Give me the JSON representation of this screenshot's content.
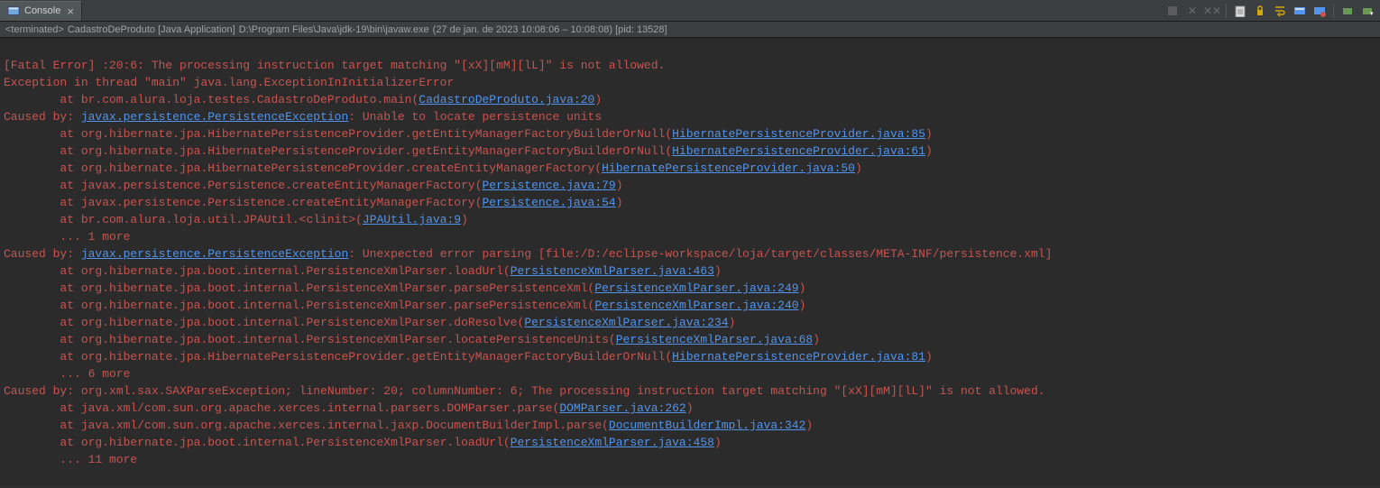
{
  "tab": {
    "label": "Console"
  },
  "status": {
    "terminated": "<terminated>",
    "app": "CadastroDeProduto [Java Application]",
    "path": "D:\\Program Files\\Java\\jdk-19\\bin\\javaw.exe",
    "meta": "(27 de jan. de 2023 10:08:06 – 10:08:08) [pid: 13528]"
  },
  "lines": {
    "l1a": "[Fatal Error] :20:6: The processing instruction target matching \"[xX][mM][lL]\" is not allowed.",
    "l2a": "Exception in thread \"main\" ",
    "l2b": "java.lang.ExceptionInInitializerError",
    "l3a": "\tat br.com.alura.loja.testes.CadastroDeProduto.main(",
    "l3l": "CadastroDeProduto.java:20",
    "l3c": ")",
    "l4a": "Caused by: ",
    "l4l": "javax.persistence.PersistenceException",
    "l4b": ": Unable to locate persistence units",
    "l5a": "\tat org.hibernate.jpa.HibernatePersistenceProvider.getEntityManagerFactoryBuilderOrNull(",
    "l5l": "HibernatePersistenceProvider.java:85",
    "l5c": ")",
    "l6a": "\tat org.hibernate.jpa.HibernatePersistenceProvider.getEntityManagerFactoryBuilderOrNull(",
    "l6l": "HibernatePersistenceProvider.java:61",
    "l6c": ")",
    "l7a": "\tat org.hibernate.jpa.HibernatePersistenceProvider.createEntityManagerFactory(",
    "l7l": "HibernatePersistenceProvider.java:50",
    "l7c": ")",
    "l8a": "\tat javax.persistence.Persistence.createEntityManagerFactory(",
    "l8l": "Persistence.java:79",
    "l8c": ")",
    "l9a": "\tat javax.persistence.Persistence.createEntityManagerFactory(",
    "l9l": "Persistence.java:54",
    "l9c": ")",
    "l10a": "\tat br.com.alura.loja.util.JPAUtil.<clinit>(",
    "l10l": "JPAUtil.java:9",
    "l10c": ")",
    "l11a": "\t... 1 more",
    "l12a": "Caused by: ",
    "l12l": "javax.persistence.PersistenceException",
    "l12b": ": Unexpected error parsing [file:/D:/eclipse-workspace/loja/target/classes/META-INF/persistence.xml]",
    "l13a": "\tat org.hibernate.jpa.boot.internal.PersistenceXmlParser.loadUrl(",
    "l13l": "PersistenceXmlParser.java:463",
    "l13c": ")",
    "l14a": "\tat org.hibernate.jpa.boot.internal.PersistenceXmlParser.parsePersistenceXml(",
    "l14l": "PersistenceXmlParser.java:249",
    "l14c": ")",
    "l15a": "\tat org.hibernate.jpa.boot.internal.PersistenceXmlParser.parsePersistenceXml(",
    "l15l": "PersistenceXmlParser.java:240",
    "l15c": ")",
    "l16a": "\tat org.hibernate.jpa.boot.internal.PersistenceXmlParser.doResolve(",
    "l16l": "PersistenceXmlParser.java:234",
    "l16c": ")",
    "l17a": "\tat org.hibernate.jpa.boot.internal.PersistenceXmlParser.locatePersistenceUnits(",
    "l17l": "PersistenceXmlParser.java:68",
    "l17c": ")",
    "l18a": "\tat org.hibernate.jpa.HibernatePersistenceProvider.getEntityManagerFactoryBuilderOrNull(",
    "l18l": "HibernatePersistenceProvider.java:81",
    "l18c": ")",
    "l19a": "\t... 6 more",
    "l20a": "Caused by: org.xml.sax.SAXParseException; lineNumber: 20; columnNumber: 6; The processing instruction target matching \"[xX][mM][lL]\" is not allowed.",
    "l21a": "\tat java.xml/com.sun.org.apache.xerces.internal.parsers.DOMParser.parse(",
    "l21l": "DOMParser.java:262",
    "l21c": ")",
    "l22a": "\tat java.xml/com.sun.org.apache.xerces.internal.jaxp.DocumentBuilderImpl.parse(",
    "l22l": "DocumentBuilderImpl.java:342",
    "l22c": ")",
    "l23a": "\tat org.hibernate.jpa.boot.internal.PersistenceXmlParser.loadUrl(",
    "l23l": "PersistenceXmlParser.java:458",
    "l23c": ")",
    "l24a": "\t... 11 more"
  }
}
